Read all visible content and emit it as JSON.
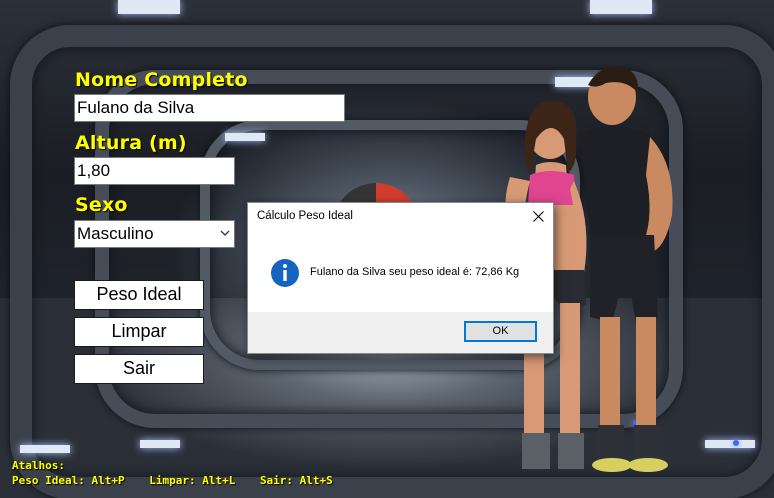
{
  "form": {
    "name_label": "Nome Completo",
    "name_value": "Fulano da Silva",
    "height_label": "Altura (m)",
    "height_value": "1,80",
    "sex_label": "Sexo",
    "sex_value": "Masculino",
    "ideal_weight_button": "Peso Ideal",
    "clear_button": "Limpar",
    "exit_button": "Sair"
  },
  "shortcuts": {
    "title": "Atalhos:",
    "ideal_weight": "Peso Ideal: Alt+P",
    "clear": "Limpar: Alt+L",
    "exit": "Sair: Alt+S"
  },
  "dialog": {
    "title": "Cálculo Peso Ideal",
    "message": "Fulano da Silva seu peso ideal é: 72,86 Kg",
    "ok_label": "OK",
    "icon": "info-icon"
  },
  "colors": {
    "label_yellow": "#ffff00",
    "dialog_accent": "#0078d7",
    "info_icon_blue": "#1565c0"
  }
}
